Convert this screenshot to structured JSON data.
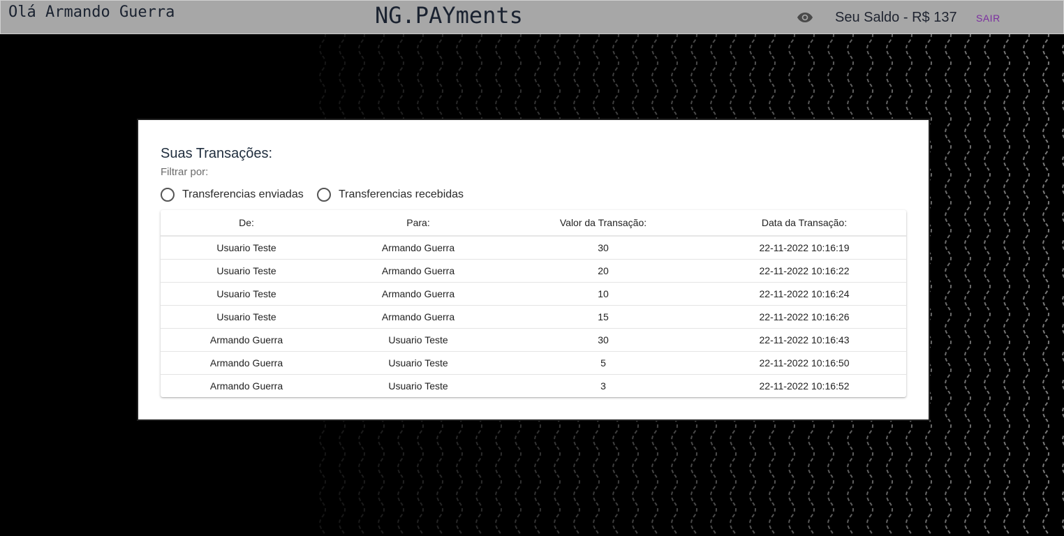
{
  "header": {
    "greeting": "Olá Armando Guerra",
    "brand": "NG.PAYments",
    "balance": "Seu Saldo - R$ 137",
    "logout_label": "SAIR",
    "eye_icon": "eye-icon"
  },
  "transactions": {
    "title": "Suas Transações:",
    "filter_label": "Filtrar por:",
    "filters": [
      {
        "label": "Transferencias enviadas"
      },
      {
        "label": "Transferencias recebidas"
      }
    ],
    "columns": [
      "De:",
      "Para:",
      "Valor da Transação:",
      "Data da Transação:"
    ],
    "rows": [
      [
        "Usuario Teste",
        "Armando Guerra",
        "30",
        "22-11-2022 10:16:19"
      ],
      [
        "Usuario Teste",
        "Armando Guerra",
        "20",
        "22-11-2022 10:16:22"
      ],
      [
        "Usuario Teste",
        "Armando Guerra",
        "10",
        "22-11-2022 10:16:24"
      ],
      [
        "Usuario Teste",
        "Armando Guerra",
        "15",
        "22-11-2022 10:16:26"
      ],
      [
        "Armando Guerra",
        "Usuario Teste",
        "30",
        "22-11-2022 10:16:43"
      ],
      [
        "Armando Guerra",
        "Usuario Teste",
        "5",
        "22-11-2022 10:16:50"
      ],
      [
        "Armando Guerra",
        "Usuario Teste",
        "3",
        "22-11-2022 10:16:52"
      ]
    ]
  },
  "colors": {
    "background": "#000000",
    "topbar": "#a7a7a7",
    "logout": "#7b2ea0"
  }
}
